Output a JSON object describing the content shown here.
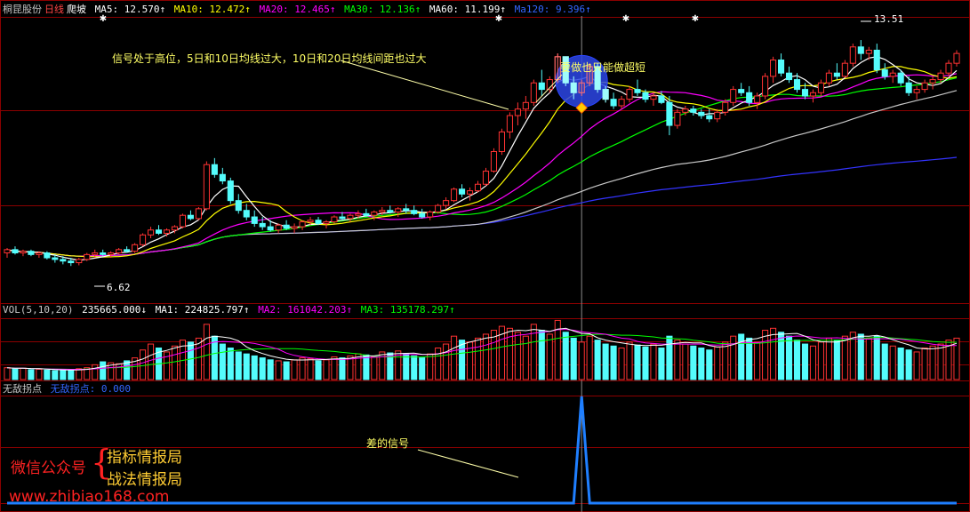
{
  "header": {
    "stock_name": "桐昆股份",
    "period": "日线",
    "pattern": "爬坡",
    "ma_readouts": [
      {
        "label": "MA5: 12.570↑",
        "color": "#ffffff"
      },
      {
        "label": "MA10: 12.472↑",
        "color": "#ffff00"
      },
      {
        "label": "MA20: 12.465↑",
        "color": "#ff00ff"
      },
      {
        "label": "MA30: 12.136↑",
        "color": "#00ff00"
      },
      {
        "label": "MA60: 11.199↑",
        "color": "#ffffff"
      },
      {
        "label": "Ma120: 9.396↑",
        "color": "#3366ff"
      }
    ]
  },
  "vol_header": {
    "label": "VOL(5,10,20)",
    "items": [
      {
        "label": "235665.000↓",
        "color": "#ffffff"
      },
      {
        "label": "MA1: 224825.797↑",
        "color": "#ffffff"
      },
      {
        "label": "MA2: 161042.203↑",
        "color": "#ff00ff"
      },
      {
        "label": "MA3: 135178.297↑",
        "color": "#00ff00"
      }
    ]
  },
  "ind_header": {
    "label": "无敌拐点",
    "value_label": "无敌拐点: 0.000"
  },
  "annotations": {
    "top_left": "信号处于高位，5日和10日均线过大，10日和20日均线间距也过大",
    "top_right": "要做也只能做超短",
    "bottom": "差的信号",
    "high_price": "13.51",
    "low_price": "6.62"
  },
  "watermark": {
    "left_text": "微信公众号",
    "brace": "{",
    "line1": "指标情报局",
    "line2": "战法情报局",
    "url": "www.zhibiao168.com"
  },
  "colors": {
    "up": "#ff3232",
    "down": "#54fcfc",
    "grid": "#8b0000",
    "signal_line": "#1f7fff",
    "ma5": "#ffffff",
    "ma10": "#ffff00",
    "ma20": "#ff00ff",
    "ma30": "#00ff00",
    "ma60": "#c8c8c8",
    "ma120": "#3333ff"
  },
  "chart_data": {
    "type": "candlestick",
    "price_range": [
      5.6,
      14.3
    ],
    "volume_range": [
      0,
      320000
    ],
    "candles": [
      [
        7.0,
        7.15,
        6.85,
        7.1
      ],
      [
        7.1,
        7.2,
        6.95,
        7.0
      ],
      [
        7.0,
        7.1,
        6.9,
        7.05
      ],
      [
        7.05,
        7.1,
        6.9,
        6.95
      ],
      [
        6.95,
        7.05,
        6.85,
        7.0
      ],
      [
        7.0,
        7.05,
        6.8,
        6.85
      ],
      [
        6.85,
        6.95,
        6.7,
        6.8
      ],
      [
        6.8,
        6.9,
        6.65,
        6.75
      ],
      [
        6.75,
        6.85,
        6.6,
        6.7
      ],
      [
        6.7,
        6.85,
        6.62,
        6.8
      ],
      [
        6.8,
        7.0,
        6.75,
        6.95
      ],
      [
        6.95,
        7.1,
        6.85,
        7.0
      ],
      [
        7.0,
        7.1,
        6.9,
        6.95
      ],
      [
        6.95,
        7.05,
        6.85,
        7.0
      ],
      [
        7.0,
        7.15,
        6.95,
        7.1
      ],
      [
        7.1,
        7.2,
        7.0,
        7.05
      ],
      [
        7.05,
        7.3,
        7.0,
        7.25
      ],
      [
        7.25,
        7.6,
        7.2,
        7.55
      ],
      [
        7.55,
        7.8,
        7.45,
        7.7
      ],
      [
        7.7,
        7.85,
        7.55,
        7.6
      ],
      [
        7.6,
        7.75,
        7.5,
        7.7
      ],
      [
        7.7,
        7.85,
        7.6,
        7.8
      ],
      [
        7.8,
        8.2,
        7.75,
        8.15
      ],
      [
        8.15,
        8.3,
        8.0,
        8.05
      ],
      [
        8.05,
        8.4,
        8.0,
        8.35
      ],
      [
        8.35,
        9.8,
        8.3,
        9.7
      ],
      [
        9.7,
        9.9,
        9.3,
        9.4
      ],
      [
        9.4,
        9.6,
        9.1,
        9.2
      ],
      [
        9.2,
        9.3,
        8.5,
        8.6
      ],
      [
        8.6,
        8.8,
        8.2,
        8.3
      ],
      [
        8.3,
        8.5,
        8.0,
        8.1
      ],
      [
        8.1,
        8.3,
        7.8,
        7.9
      ],
      [
        7.9,
        8.1,
        7.7,
        7.8
      ],
      [
        7.8,
        8.0,
        7.65,
        7.7
      ],
      [
        7.7,
        7.9,
        7.6,
        7.85
      ],
      [
        7.85,
        8.0,
        7.7,
        7.75
      ],
      [
        7.75,
        7.9,
        7.6,
        7.8
      ],
      [
        7.8,
        8.0,
        7.7,
        7.95
      ],
      [
        7.95,
        8.1,
        7.85,
        8.0
      ],
      [
        8.0,
        8.1,
        7.85,
        7.9
      ],
      [
        7.9,
        8.0,
        7.75,
        7.95
      ],
      [
        7.95,
        8.15,
        7.9,
        8.1
      ],
      [
        8.1,
        8.25,
        8.0,
        8.05
      ],
      [
        8.05,
        8.2,
        7.95,
        8.15
      ],
      [
        8.15,
        8.3,
        8.05,
        8.2
      ],
      [
        8.2,
        8.35,
        8.1,
        8.15
      ],
      [
        8.15,
        8.3,
        8.0,
        8.25
      ],
      [
        8.25,
        8.4,
        8.15,
        8.3
      ],
      [
        8.3,
        8.45,
        8.2,
        8.25
      ],
      [
        8.25,
        8.4,
        8.1,
        8.35
      ],
      [
        8.35,
        8.5,
        8.2,
        8.3
      ],
      [
        8.3,
        8.45,
        8.15,
        8.2
      ],
      [
        8.2,
        8.35,
        8.05,
        8.1
      ],
      [
        8.1,
        8.3,
        8.0,
        8.25
      ],
      [
        8.25,
        8.5,
        8.2,
        8.45
      ],
      [
        8.45,
        8.7,
        8.35,
        8.6
      ],
      [
        8.6,
        9.0,
        8.55,
        8.95
      ],
      [
        8.95,
        9.1,
        8.7,
        8.8
      ],
      [
        8.8,
        9.0,
        8.6,
        8.9
      ],
      [
        8.9,
        9.2,
        8.85,
        9.1
      ],
      [
        9.1,
        9.6,
        9.05,
        9.5
      ],
      [
        9.5,
        10.2,
        9.45,
        10.1
      ],
      [
        10.1,
        10.8,
        10.0,
        10.7
      ],
      [
        10.7,
        11.3,
        10.5,
        11.2
      ],
      [
        11.2,
        11.6,
        10.9,
        11.4
      ],
      [
        11.4,
        11.8,
        11.1,
        11.6
      ],
      [
        11.6,
        12.3,
        11.5,
        12.2
      ],
      [
        12.2,
        12.6,
        11.8,
        12.0
      ],
      [
        12.0,
        12.4,
        11.9,
        12.3
      ],
      [
        12.3,
        13.1,
        12.2,
        13.0
      ],
      [
        13.0,
        13.0,
        12.1,
        12.2
      ],
      [
        12.2,
        12.4,
        11.7,
        11.9
      ],
      [
        11.9,
        12.3,
        11.8,
        12.2
      ],
      [
        12.2,
        12.8,
        12.1,
        12.7
      ],
      [
        12.7,
        12.8,
        11.9,
        12.0
      ],
      [
        12.0,
        12.1,
        11.6,
        11.7
      ],
      [
        11.7,
        11.9,
        11.4,
        11.5
      ],
      [
        11.5,
        11.8,
        11.4,
        11.7
      ],
      [
        11.7,
        12.1,
        11.6,
        12.0
      ],
      [
        12.0,
        12.3,
        11.8,
        11.9
      ],
      [
        11.9,
        12.0,
        11.6,
        11.7
      ],
      [
        11.7,
        11.9,
        11.5,
        11.8
      ],
      [
        11.8,
        11.95,
        11.55,
        11.6
      ],
      [
        11.6,
        11.8,
        10.6,
        10.9
      ],
      [
        10.9,
        11.4,
        10.8,
        11.3
      ],
      [
        11.3,
        11.5,
        11.2,
        11.4
      ],
      [
        11.4,
        11.5,
        11.2,
        11.3
      ],
      [
        11.3,
        11.4,
        11.1,
        11.2
      ],
      [
        11.2,
        11.4,
        11.0,
        11.1
      ],
      [
        11.1,
        11.4,
        11.0,
        11.3
      ],
      [
        11.3,
        11.7,
        11.2,
        11.6
      ],
      [
        11.6,
        12.1,
        11.5,
        12.0
      ],
      [
        12.0,
        12.2,
        11.8,
        11.9
      ],
      [
        11.9,
        12.1,
        11.5,
        11.6
      ],
      [
        11.6,
        11.9,
        11.4,
        11.8
      ],
      [
        11.8,
        12.5,
        11.7,
        12.4
      ],
      [
        12.4,
        13.0,
        12.2,
        12.9
      ],
      [
        12.9,
        13.1,
        12.4,
        12.5
      ],
      [
        12.5,
        12.7,
        12.2,
        12.3
      ],
      [
        12.3,
        12.5,
        11.9,
        12.0
      ],
      [
        12.0,
        12.2,
        11.7,
        11.8
      ],
      [
        11.8,
        12.0,
        11.6,
        11.9
      ],
      [
        11.9,
        12.3,
        11.8,
        12.2
      ],
      [
        12.2,
        12.6,
        12.1,
        12.5
      ],
      [
        12.5,
        12.8,
        12.3,
        12.4
      ],
      [
        12.4,
        12.9,
        12.35,
        12.8
      ],
      [
        12.8,
        13.4,
        12.7,
        13.3
      ],
      [
        13.3,
        13.51,
        12.9,
        13.1
      ],
      [
        13.1,
        13.3,
        12.9,
        13.2
      ],
      [
        13.2,
        13.4,
        12.5,
        12.6
      ],
      [
        12.6,
        12.8,
        12.3,
        12.4
      ],
      [
        12.4,
        12.6,
        12.2,
        12.5
      ],
      [
        12.5,
        12.6,
        12.1,
        12.2
      ],
      [
        12.2,
        12.4,
        11.8,
        11.9
      ],
      [
        11.9,
        12.1,
        11.7,
        12.0
      ],
      [
        12.0,
        12.3,
        11.9,
        12.2
      ],
      [
        12.2,
        12.4,
        12.0,
        12.3
      ],
      [
        12.3,
        12.6,
        12.2,
        12.5
      ],
      [
        12.5,
        12.9,
        12.4,
        12.8
      ],
      [
        12.8,
        13.2,
        12.7,
        13.1
      ]
    ],
    "volumes": [
      60000,
      55000,
      58000,
      50000,
      52000,
      48000,
      45000,
      50000,
      47000,
      55000,
      60000,
      75000,
      90000,
      85000,
      80000,
      95000,
      110000,
      150000,
      180000,
      160000,
      140000,
      170000,
      200000,
      190000,
      210000,
      280000,
      220000,
      180000,
      160000,
      140000,
      130000,
      120000,
      110000,
      100000,
      95000,
      90000,
      100000,
      110000,
      105000,
      95000,
      100000,
      115000,
      110000,
      120000,
      130000,
      125000,
      115000,
      140000,
      135000,
      145000,
      130000,
      120000,
      110000,
      130000,
      160000,
      180000,
      220000,
      200000,
      190000,
      210000,
      230000,
      250000,
      270000,
      260000,
      240000,
      220000,
      280000,
      250000,
      230000,
      300000,
      240000,
      210000,
      190000,
      220000,
      200000,
      180000,
      170000,
      160000,
      190000,
      175000,
      165000,
      180000,
      160000,
      220000,
      200000,
      180000,
      170000,
      160000,
      150000,
      165000,
      190000,
      220000,
      230000,
      210000,
      190000,
      250000,
      260000,
      240000,
      220000,
      200000,
      180000,
      170000,
      190000,
      210000,
      200000,
      220000,
      240000,
      230000,
      210000,
      220000,
      180000,
      170000,
      160000,
      150000,
      140000,
      160000,
      170000,
      180000,
      200000,
      210000
    ],
    "signal_index": 72,
    "signal_range": [
      0,
      1
    ]
  }
}
